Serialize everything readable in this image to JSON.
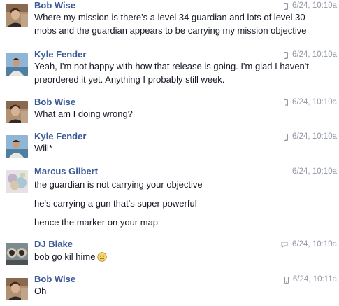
{
  "messages": [
    {
      "sender": "Bob Wise",
      "time": "6/24, 10:10a",
      "source_icon": "mobile-phone-icon",
      "lines": [
        "Where my mission is there's a level 34 guardian and lots of level 30",
        "mobs and the guardian appears to be carrying my mission objective"
      ]
    },
    {
      "sender": "Kyle Fender",
      "time": "6/24, 10:10a",
      "source_icon": "mobile-phone-icon",
      "lines": [
        "Yeah, I'm not happy with how that release is going. I'm glad I haven't",
        "preordered it yet. Anything I probably still week."
      ]
    },
    {
      "sender": "Bob Wise",
      "time": "6/24, 10:10a",
      "source_icon": "mobile-phone-icon",
      "lines": [
        "What am I doing wrong?"
      ]
    },
    {
      "sender": "Kyle Fender",
      "time": "6/24, 10:10a",
      "source_icon": "mobile-phone-icon",
      "lines": [
        "Will*"
      ]
    },
    {
      "sender": "Marcus Gilbert",
      "time": "6/24, 10:10a",
      "source_icon": "",
      "lines": [
        "the guardian is not carrying your objective",
        "he's carrying a gun that's super powerful",
        "hence the marker on your map"
      ]
    },
    {
      "sender": "DJ Blake",
      "time": "6/24, 10:10a",
      "source_icon": "chat-bubble-icon",
      "lines": [
        "bob go kil hime"
      ],
      "emoji": "straight-face-emoji-icon"
    },
    {
      "sender": "Bob Wise",
      "time": "6/24, 10:11a",
      "source_icon": "mobile-phone-icon",
      "lines": [
        "Oh"
      ]
    }
  ],
  "colors": {
    "sender_name": "#3b5998",
    "timestamp": "#9197a3",
    "body_text": "#141823"
  }
}
